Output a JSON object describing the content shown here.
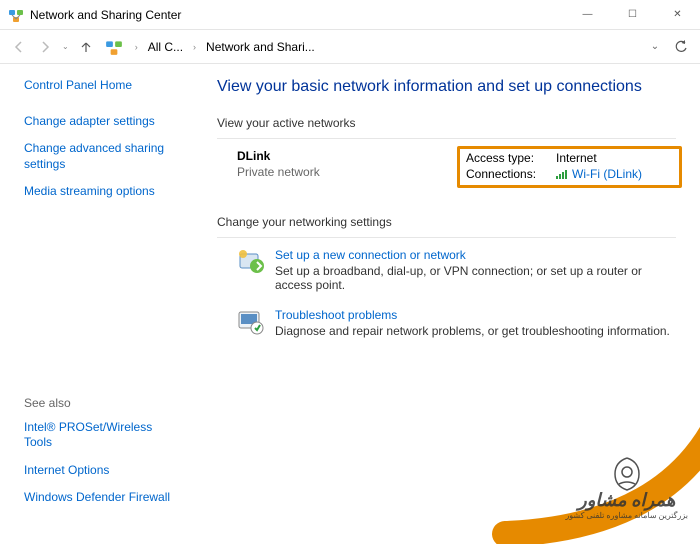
{
  "window": {
    "title": "Network and Sharing Center",
    "min": "—",
    "max": "☐",
    "close": "✕"
  },
  "breadcrumb": {
    "allc": "All C...",
    "page": "Network and Shari...",
    "dropdown": "⌄"
  },
  "sidebar": {
    "home": "Control Panel Home",
    "adapter": "Change adapter settings",
    "sharing": "Change advanced sharing settings",
    "streaming": "Media streaming options",
    "seealso": "See also",
    "intel": "Intel® PROSet/Wireless Tools",
    "internet": "Internet Options",
    "firewall": "Windows Defender Firewall"
  },
  "main": {
    "heading": "View your basic network information and set up connections",
    "active_label": "View your active networks",
    "network": {
      "name": "DLink",
      "type": "Private network",
      "access_lbl": "Access type:",
      "access_val": "Internet",
      "conn_lbl": "Connections:",
      "conn_val": "Wi-Fi (DLink)"
    },
    "change_label": "Change your networking settings",
    "opt1": {
      "title": "Set up a new connection or network",
      "desc": "Set up a broadband, dial-up, or VPN connection; or set up a router or access point."
    },
    "opt2": {
      "title": "Troubleshoot problems",
      "desc": "Diagnose and repair network problems, or get troubleshooting information."
    }
  },
  "watermark": {
    "line1": "همراه مشاور",
    "line2": "بزرگترین سامانه مشاوره تلفنی کشور"
  }
}
